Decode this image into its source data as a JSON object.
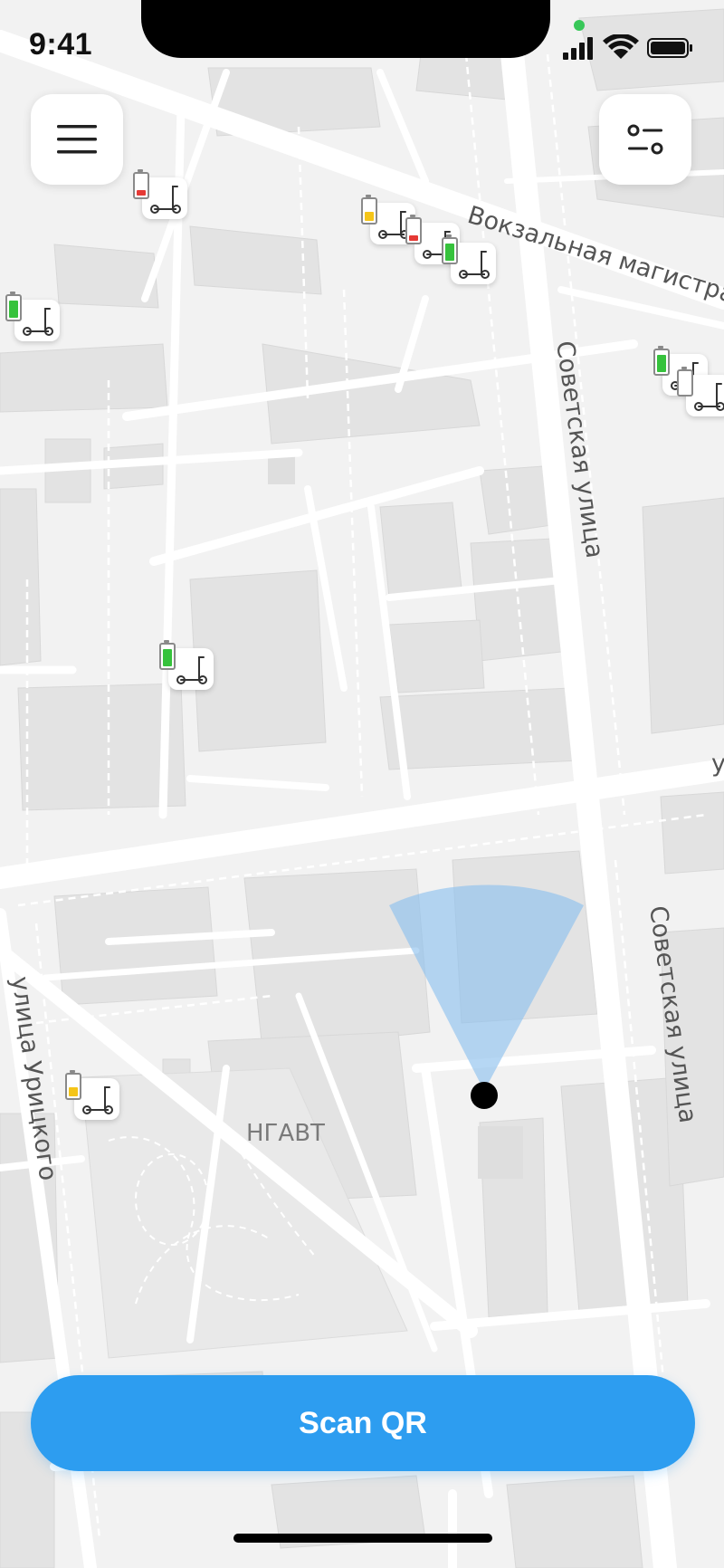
{
  "status_bar": {
    "time": "9:41"
  },
  "map": {
    "streets": {
      "vokzalnaya": "Вокзальная магистраль",
      "sovetskaya_top": "Советская улица",
      "sovetskaya_bottom": "Советская улица",
      "uritskogo": "улица Урицкого",
      "edge_fragment": "у"
    },
    "poi": {
      "ngavt": "НГАВТ"
    },
    "scooters": [
      {
        "battery": "low",
        "battery_color": "#e53935"
      },
      {
        "battery": "medium",
        "battery_color": "#f5c518"
      },
      {
        "battery": "low",
        "battery_color": "#e53935"
      },
      {
        "battery": "full",
        "battery_color": "#36c23c"
      },
      {
        "battery": "full",
        "battery_color": "#36c23c"
      },
      {
        "battery": "full",
        "battery_color": "#36c23c"
      },
      {
        "battery": "unknown",
        "battery_color": "#e0e0e0"
      },
      {
        "battery": "full",
        "battery_color": "#36c23c"
      },
      {
        "battery": "medium",
        "battery_color": "#f5c518"
      }
    ]
  },
  "controls": {
    "menu_icon": "hamburger-menu-icon",
    "filter_icon": "filter-toggle-icon",
    "scan_label": "Scan QR"
  },
  "colors": {
    "accent": "#2d9df0",
    "location_cone": "#8fc1ee",
    "location_dot": "#000000"
  }
}
